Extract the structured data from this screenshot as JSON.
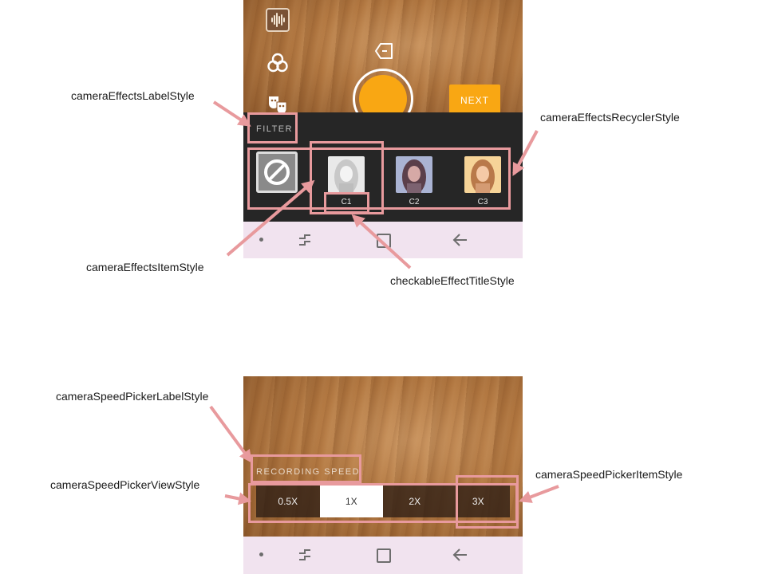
{
  "top_screen": {
    "next_label": "NEXT",
    "filter_label": "FILTER",
    "effects": [
      {
        "title": "C1",
        "tint": "#d8d8d8"
      },
      {
        "title": "C2",
        "tint": "#9aa6c8"
      },
      {
        "title": "C3",
        "tint": "#f0c38e"
      }
    ]
  },
  "bottom_screen": {
    "recording_label": "RECORDING SPEED",
    "speeds": [
      "0.5X",
      "1X",
      "2X",
      "3X"
    ],
    "selected_speed": "1X"
  },
  "annotations": {
    "effects_label": "cameraEffectsLabelStyle",
    "effects_recycler": "cameraEffectsRecyclerStyle",
    "effects_item": "cameraEffectsItemStyle",
    "effect_title": "checkableEffectTitleStyle",
    "speed_label": "cameraSpeedPickerLabelStyle",
    "speed_view": "cameraSpeedPickerViewStyle",
    "speed_item": "cameraSpeedPickerItemStyle"
  },
  "colors": {
    "accent": "#f9a713",
    "callout": "#e89a9d",
    "panel": "#262626",
    "navbar": "#f1e3ef"
  }
}
